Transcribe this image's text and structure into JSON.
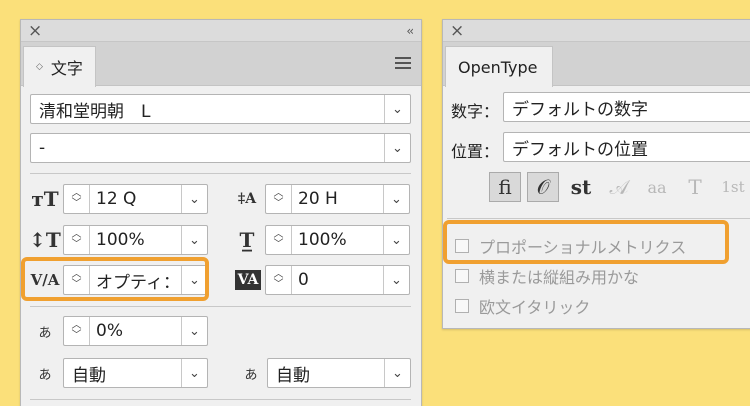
{
  "character_panel": {
    "tab_label": "文字",
    "font_family": "清和堂明朝　L",
    "font_style": "-",
    "font_size": "12 Q",
    "leading": "20 H",
    "vertical_scale": "100%",
    "horizontal_scale": "100%",
    "kerning": "オプティ：",
    "tracking": "0",
    "tsume": "0%",
    "aki_left": "自動",
    "aki_right": "自動"
  },
  "opentype_panel": {
    "tab_label": "OpenType",
    "figure_label": "数字：",
    "figure_value": "デフォルトの数字",
    "position_label": "位置：",
    "position_value": "デフォルトの位置",
    "feature_glyphs": [
      "ﬁ",
      "𝒪",
      "st",
      "𝒜",
      "aa",
      "T",
      "1st"
    ],
    "checkboxes": [
      "プロポーショナルメトリクス",
      "横または縦組み用かな",
      "欧文イタリック"
    ]
  },
  "colors": {
    "highlight": "#f0a030",
    "background": "#fbe07a"
  }
}
